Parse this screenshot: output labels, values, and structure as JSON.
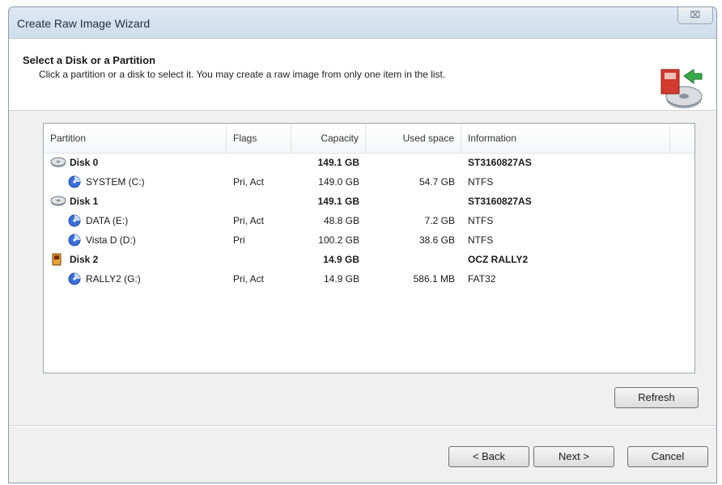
{
  "window": {
    "title": "Create Raw Image Wizard",
    "close_label": "⌧"
  },
  "header": {
    "title": "Select a Disk or a Partition",
    "subtitle": "Click a partition or a disk to select it. You may create a raw image from only one item in the list."
  },
  "list": {
    "columns": {
      "partition": "Partition",
      "flags": "Flags",
      "capacity": "Capacity",
      "used": "Used space",
      "info": "Information"
    },
    "rows": [
      {
        "kind": "disk",
        "icon": "hard-disk-icon",
        "name": "Disk 0",
        "flags": "",
        "capacity": "149.1 GB",
        "used": "",
        "info": "ST3160827AS"
      },
      {
        "kind": "partition",
        "icon": "partition-icon",
        "name": "SYSTEM (C:)",
        "flags": "Pri, Act",
        "capacity": "149.0 GB",
        "used": "54.7 GB",
        "info": "NTFS"
      },
      {
        "kind": "disk",
        "icon": "hard-disk-icon",
        "name": "Disk 1",
        "flags": "",
        "capacity": "149.1 GB",
        "used": "",
        "info": "ST3160827AS"
      },
      {
        "kind": "partition",
        "icon": "partition-icon",
        "name": "DATA (E:)",
        "flags": "Pri, Act",
        "capacity": "48.8 GB",
        "used": "7.2 GB",
        "info": "NTFS"
      },
      {
        "kind": "partition",
        "icon": "partition-icon",
        "name": "Vista D (D:)",
        "flags": "Pri",
        "capacity": "100.2 GB",
        "used": "38.6 GB",
        "info": "NTFS"
      },
      {
        "kind": "disk",
        "icon": "usb-drive-icon",
        "name": "Disk 2",
        "flags": "",
        "capacity": "14.9 GB",
        "used": "",
        "info": "OCZ RALLY2"
      },
      {
        "kind": "partition",
        "icon": "partition-icon",
        "name": "RALLY2 (G:)",
        "flags": "Pri, Act",
        "capacity": "14.9 GB",
        "used": "586.1 MB",
        "info": "FAT32"
      }
    ]
  },
  "buttons": {
    "refresh": "Refresh",
    "back": "< Back",
    "next": "Next >",
    "cancel": "Cancel"
  },
  "colors": {
    "partition_icon": "#3b6fd6",
    "usb_icon": "#e6a23c"
  }
}
